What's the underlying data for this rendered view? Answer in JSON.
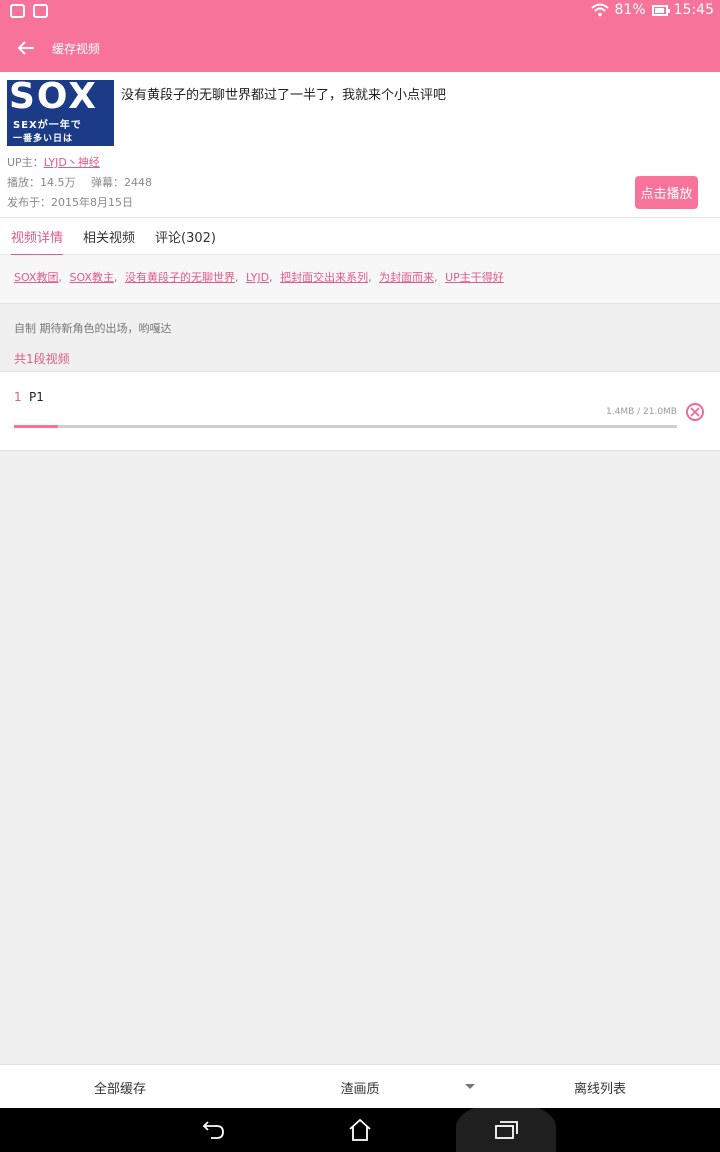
{
  "statusbar": {
    "battery_percent": "81%",
    "battery_level": 0.81,
    "time": "15:45",
    "left_icons": [
      "face-icon",
      "image-icon"
    ]
  },
  "appbar": {
    "title": "缓存视频",
    "back_icon": "arrow-left-icon"
  },
  "video": {
    "thumbnail_text": {
      "big": "SOX",
      "line1": "SEXが一年で",
      "line2": "一番多い日は"
    },
    "title": "没有黄段子的无聊世界都过了一半了，我就来个小点评吧",
    "uploader_label": "UP主：",
    "uploader": "LYJD丶神经",
    "views_label": "播放：14.5万",
    "danmaku_label": "弹幕：2448",
    "published": "发布于：2015年8月15日",
    "play_button": "点击播放"
  },
  "tabs": [
    {
      "label": "视频详情",
      "active": true
    },
    {
      "label": "相关视频",
      "active": false
    },
    {
      "label": "评论(302)",
      "active": false
    }
  ],
  "tags": [
    "SOX教团",
    "SOX教主",
    "没有黄段子的无聊世界",
    "LYJD",
    "把封面交出来系列",
    "为封面而来",
    "UP主干得好"
  ],
  "tag_separator": ",",
  "description": "自制 期待新角色的出场，哟嘎达",
  "parts_count": "共1段视频",
  "parts": [
    {
      "index": "1",
      "label": "P1",
      "size": "1.4MB / 21.0MB",
      "progress": 0.067
    }
  ],
  "bottombar": {
    "cache_all": "全部缓存",
    "quality": "渣画质",
    "offline_list": "离线列表"
  },
  "colors": {
    "accent": "#f7739a",
    "link": "#e35b87"
  }
}
